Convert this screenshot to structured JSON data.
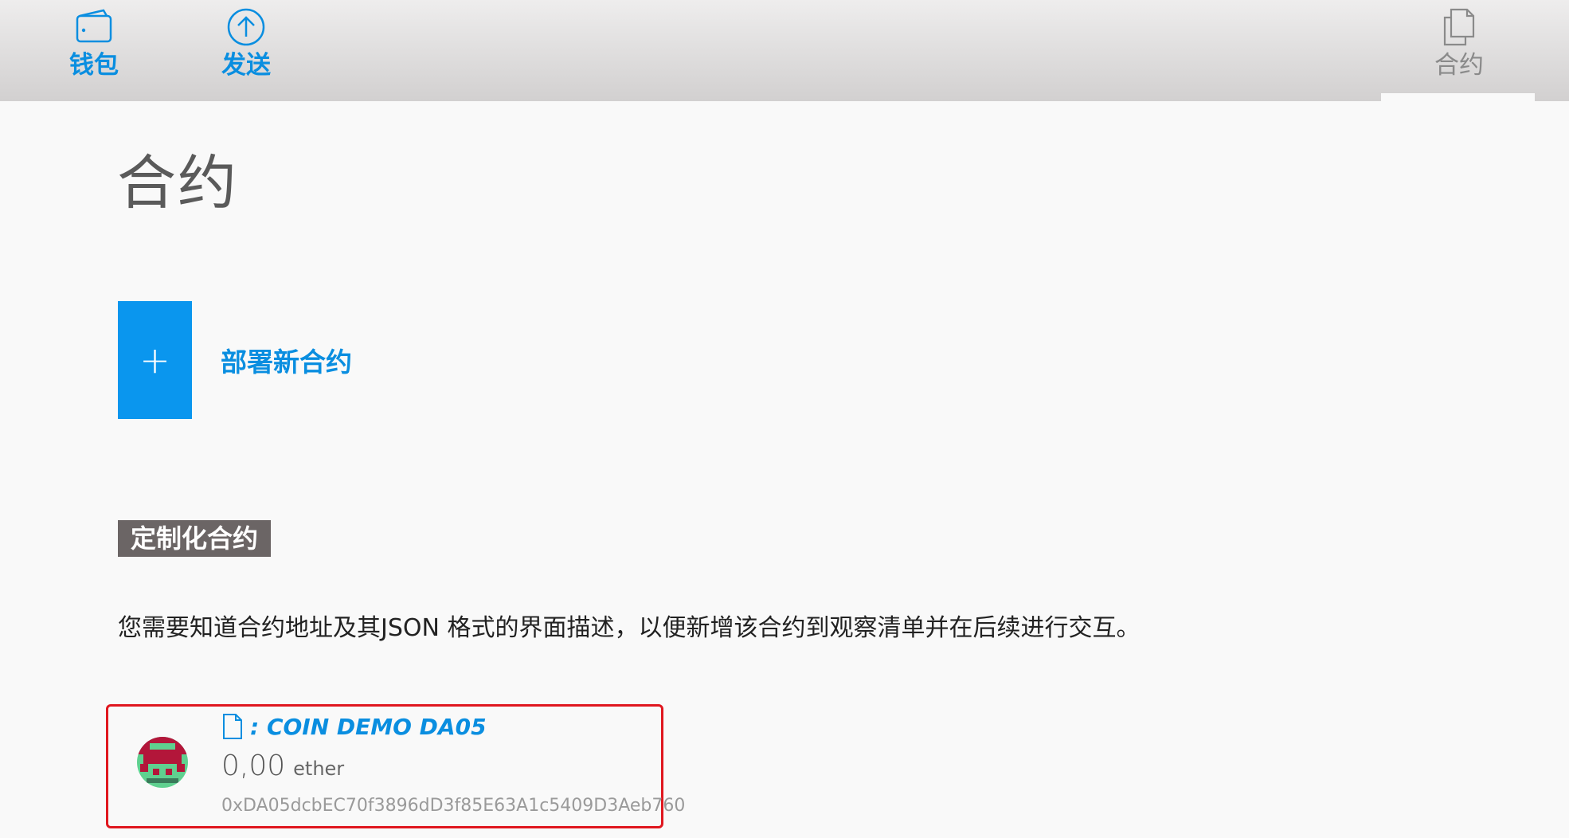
{
  "nav": {
    "wallet_label": "钱包",
    "send_label": "发送",
    "contracts_label": "合约"
  },
  "page": {
    "title": "合约",
    "deploy_plus": "+",
    "deploy_label": "部署新合约",
    "section_tag": "定制化合约",
    "description": "您需要知道合约地址及其JSON 格式的界面描述，以便新增该合约到观察清单并在后续进行交互。"
  },
  "contract": {
    "name": ": COIN DEMO DA05",
    "balance": "0,00",
    "unit": "ether",
    "address": "0xDA05dcbEC70f3896dD3f85E63A1c5409D3Aeb760"
  },
  "colors": {
    "accent": "#0a8ee0",
    "deploy_bg": "#0a96ee",
    "tag_bg": "#6b6565",
    "highlight_border": "#e0171f"
  }
}
